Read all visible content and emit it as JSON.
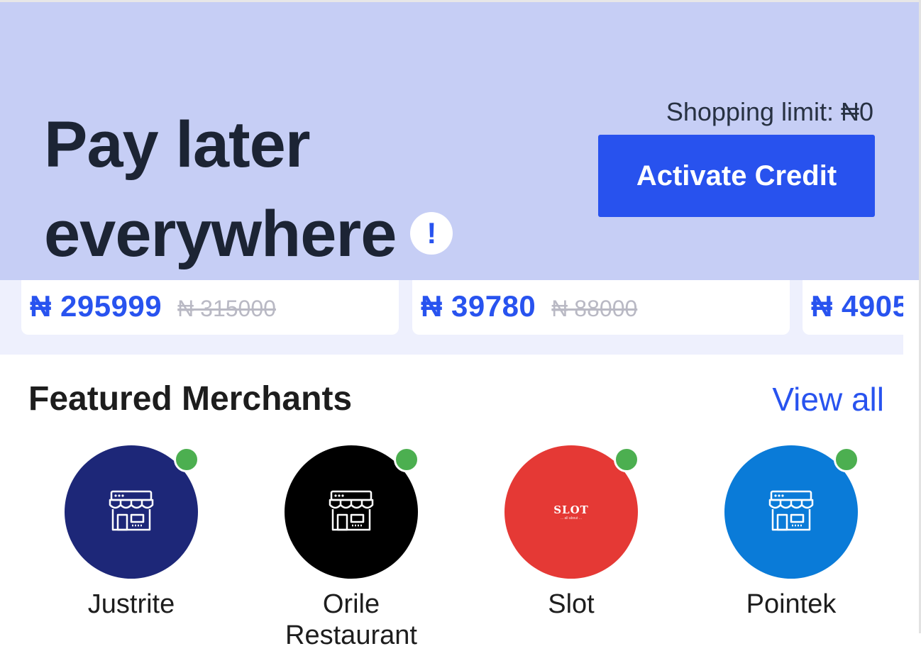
{
  "hero": {
    "title_line1": "Pay later",
    "title_line2": "everywhere",
    "info_badge": "!",
    "shopping_limit": "Shopping limit: ₦0",
    "activate_button": "Activate Credit"
  },
  "products": [
    {
      "price": "₦ 295999",
      "old_price": "₦ 315000"
    },
    {
      "price": "₦ 39780",
      "old_price": "₦ 88000"
    },
    {
      "price": "₦ 4905",
      "old_price": ""
    }
  ],
  "featured": {
    "title": "Featured Merchants",
    "view_all": "View all",
    "merchants": [
      {
        "name": "Justrite",
        "name_line2": "",
        "color": "#1d2778",
        "icon": "store-icon",
        "online": true
      },
      {
        "name": "Orile",
        "name_line2": "Restaurant",
        "color": "#000000",
        "icon": "store-icon",
        "online": true
      },
      {
        "name": "Slot",
        "name_line2": "",
        "color": "#e53935",
        "icon": "slot-logo",
        "logo_text": "SLOT",
        "logo_sub": "... all about ...",
        "online": true
      },
      {
        "name": "Pointek",
        "name_line2": "",
        "color": "#0a7bd8",
        "icon": "store-icon",
        "online": true
      }
    ]
  },
  "colors": {
    "accent": "#2853ef",
    "hero_bg": "#c6cef5",
    "online": "#4caf50"
  }
}
